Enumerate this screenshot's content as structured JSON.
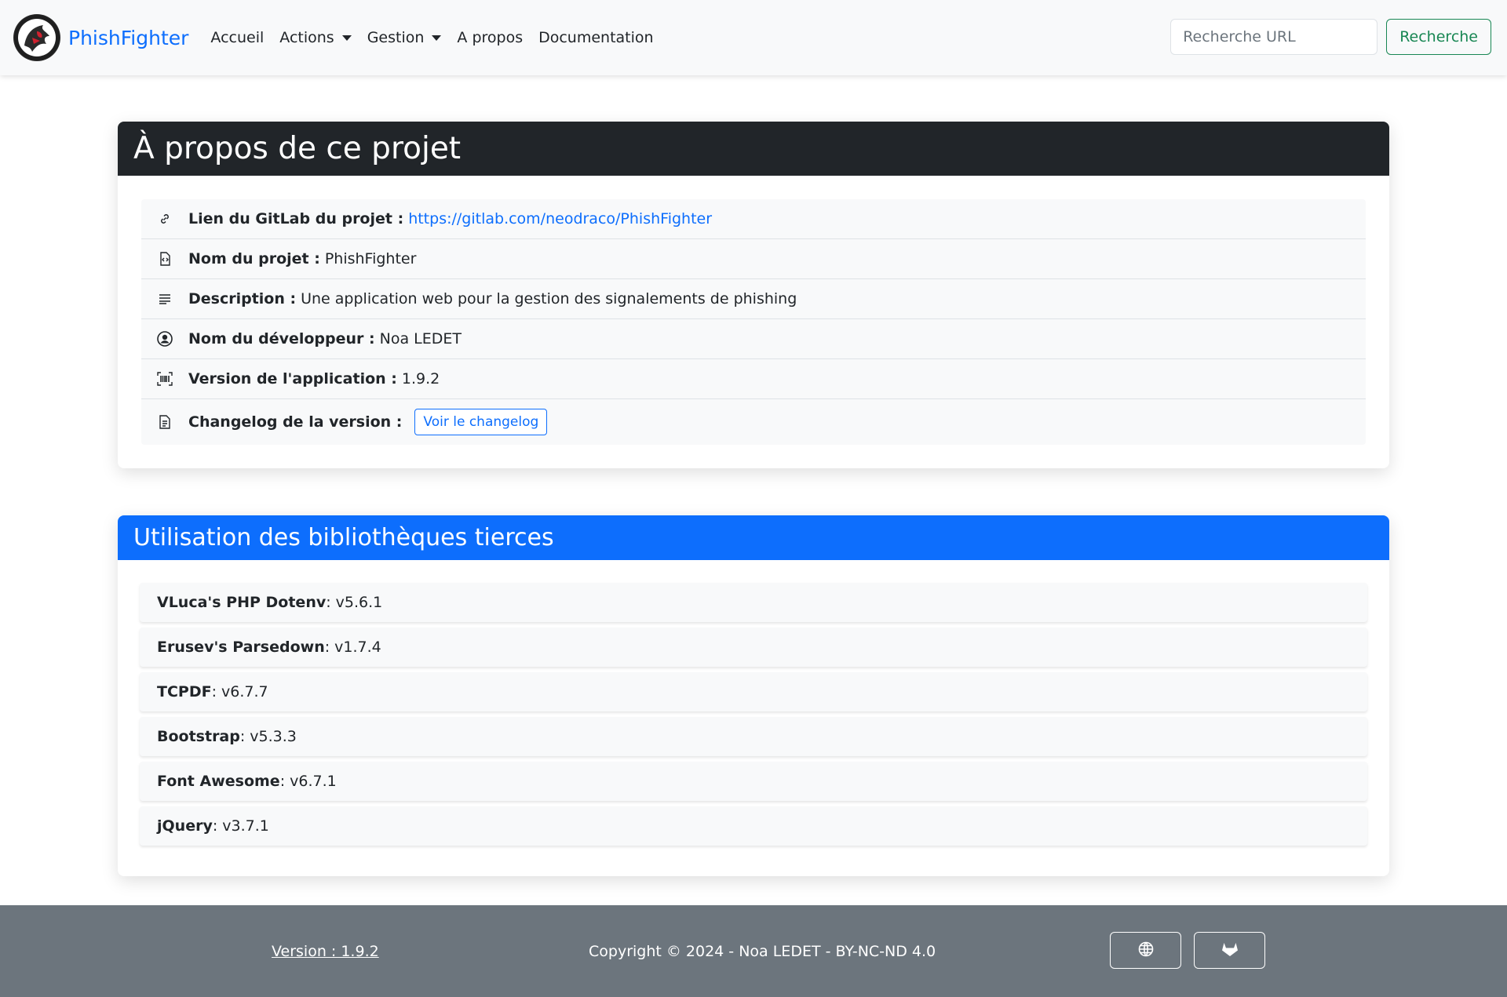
{
  "navbar": {
    "brand": "PhishFighter",
    "links": [
      "Accueil",
      "Actions",
      "Gestion",
      "A propos",
      "Documentation"
    ],
    "search_placeholder": "Recherche URL",
    "search_button": "Recherche",
    "colors": {
      "brand": "#0d6efd",
      "search_button": "#198754"
    }
  },
  "about": {
    "title": "À propos de ce projet",
    "rows": [
      {
        "icon": "link-icon",
        "label": "Lien du GitLab du projet :",
        "value": "https://gitlab.com/neodraco/PhishFighter"
      },
      {
        "icon": "file-code-icon",
        "label": "Nom du projet :",
        "value": "PhishFighter"
      },
      {
        "icon": "text-lines-icon",
        "label": "Description :",
        "value": "Une application web pour la gestion des signalements de phishing"
      },
      {
        "icon": "user-circle-icon",
        "label": "Nom du développeur :",
        "value": "Noa LEDET"
      },
      {
        "icon": "barcode-icon",
        "label": "Version de l'application :",
        "value": "1.9.2"
      },
      {
        "icon": "file-text-icon",
        "label": "Changelog de la version :",
        "value": "Voir le changelog"
      }
    ]
  },
  "libs": {
    "title": "Utilisation des bibliothèques tierces",
    "items": [
      {
        "name": "VLuca's PHP Dotenv",
        "version": " : v5.6.1"
      },
      {
        "name": "Erusev's Parsedown",
        "version": " : v1.7.4"
      },
      {
        "name": "TCPDF",
        "version": " : v6.7.7"
      },
      {
        "name": "Bootstrap",
        "version": " : v5.3.3"
      },
      {
        "name": "Font Awesome",
        "version": " : v6.7.1"
      },
      {
        "name": "jQuery",
        "version": " : v3.7.1"
      }
    ],
    "header_color": "#0d6efd"
  },
  "footer": {
    "version": "Version : 1.9.2",
    "copyright": "Copyright © 2024 - Noa LEDET - BY-NC-ND 4.0",
    "buttons": [
      "globe-icon",
      "gitlab-icon"
    ],
    "color": "#6c757d"
  }
}
